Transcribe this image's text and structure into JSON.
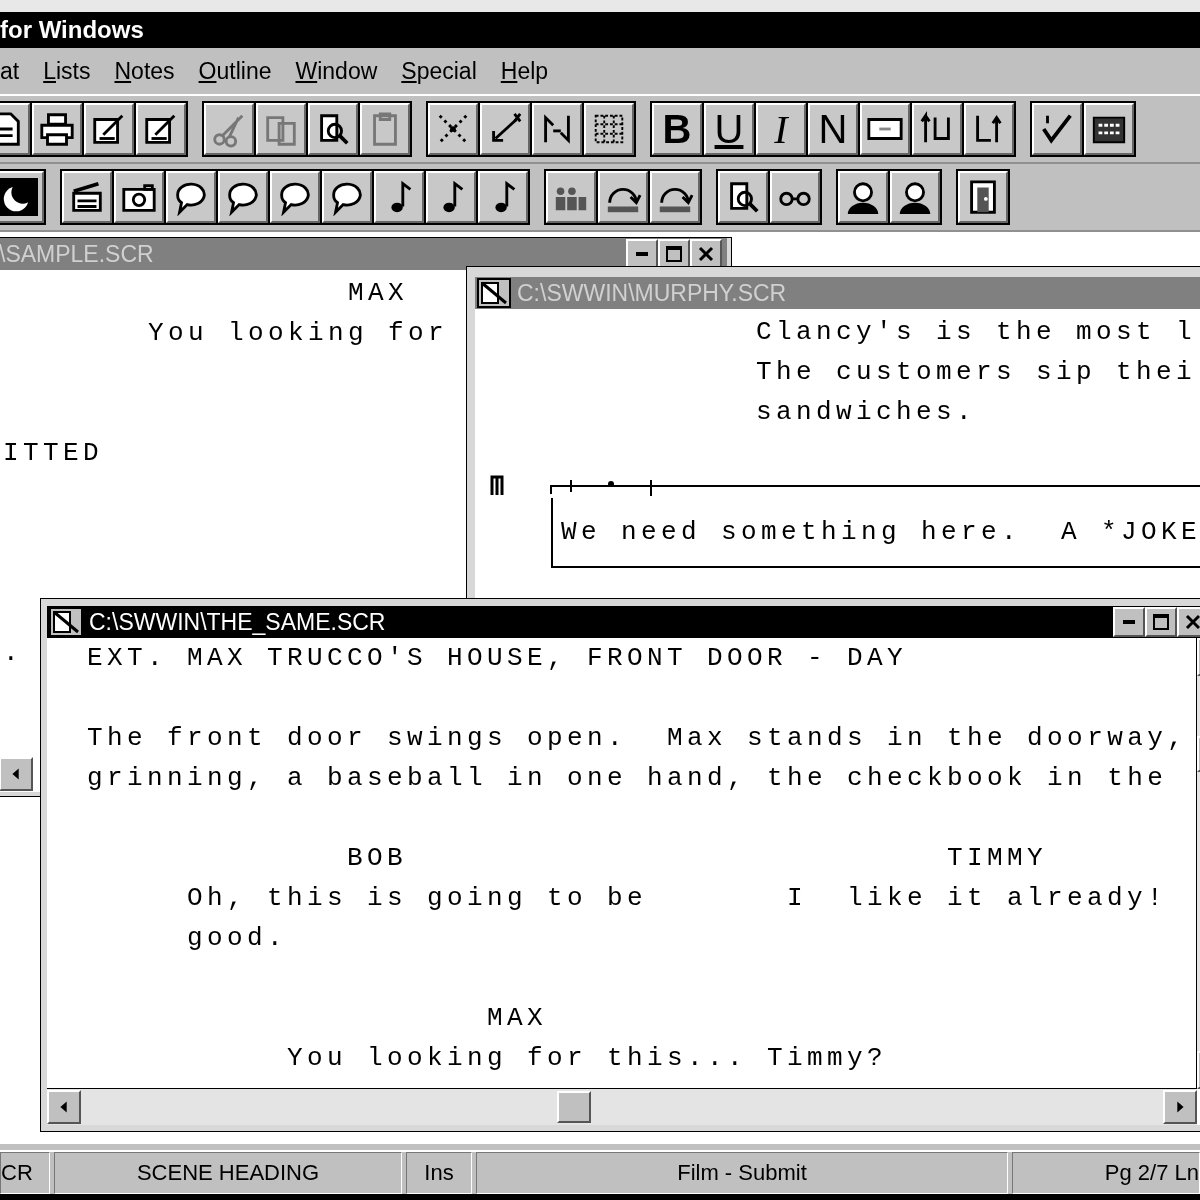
{
  "app": {
    "title": "for Windows"
  },
  "menu": [
    {
      "label": "at",
      "underlined": false
    },
    {
      "label": "Lists",
      "underlined": true
    },
    {
      "label": "Notes",
      "underlined": true
    },
    {
      "label": "Outline",
      "underlined": true
    },
    {
      "label": "Window",
      "underlined": true
    },
    {
      "label": "Special",
      "underlined": true
    },
    {
      "label": "Help",
      "underlined": true
    }
  ],
  "format_buttons": [
    {
      "label": "B",
      "kind": "bold"
    },
    {
      "label": "U",
      "kind": "underline"
    },
    {
      "label": "I",
      "kind": "italic"
    },
    {
      "label": "N",
      "kind": "normal"
    }
  ],
  "documents": [
    {
      "title": "\\SAMPLE.SCR",
      "active": false,
      "lines": [
        {
          "kind": "character",
          "text": "MAX"
        },
        {
          "kind": "dialogue",
          "text": "You looking for"
        },
        {
          "kind": "blank"
        },
        {
          "kind": "blank"
        },
        {
          "kind": "fragment",
          "text": "ITTED"
        },
        {
          "kind": "blank"
        },
        {
          "kind": "blank"
        },
        {
          "kind": "blank"
        },
        {
          "kind": "blank"
        },
        {
          "kind": "fragment",
          "text": "."
        }
      ]
    },
    {
      "title": "C:\\SWWIN\\MURPHY.SCR",
      "active": false,
      "lines": [
        {
          "kind": "action",
          "text": "Clancy's is the most l"
        },
        {
          "kind": "action",
          "text": "The customers sip thei"
        },
        {
          "kind": "action",
          "text": "sandwiches."
        },
        {
          "kind": "note",
          "text": "We need something here.  A *JOKE"
        }
      ]
    },
    {
      "title": "C:\\SWWIN\\THE_SAME.SCR",
      "active": true,
      "lines": [
        {
          "kind": "heading",
          "text": "EXT. MAX TRUCCO'S HOUSE, FRONT DOOR - DAY"
        },
        {
          "kind": "blank"
        },
        {
          "kind": "action",
          "text": "The front door swings open.  Max stands in the doorway,"
        },
        {
          "kind": "action",
          "text": "grinning, a baseball in one hand, the checkbook in the"
        },
        {
          "kind": "blank"
        },
        {
          "kind": "dual",
          "left": {
            "kind": "character",
            "text": "BOB"
          },
          "right": {
            "kind": "character",
            "text": "TIMMY"
          }
        },
        {
          "kind": "dual",
          "left": {
            "kind": "dialogue",
            "text": "Oh, this is going to be"
          },
          "right": {
            "kind": "dialogue",
            "text": "I  like it already!"
          }
        },
        {
          "kind": "dual",
          "left": {
            "kind": "dialogue",
            "text": "good."
          }
        },
        {
          "kind": "blank"
        },
        {
          "kind": "character",
          "text": "MAX"
        },
        {
          "kind": "dialogue",
          "text": "You looking for this... Timmy?"
        }
      ]
    }
  ],
  "status_bar": [
    {
      "text": "CR"
    },
    {
      "text": "SCENE HEADING"
    },
    {
      "text": "Ins"
    },
    {
      "text": "Film - Submit"
    },
    {
      "text": "Pg 2/7 Ln"
    }
  ]
}
